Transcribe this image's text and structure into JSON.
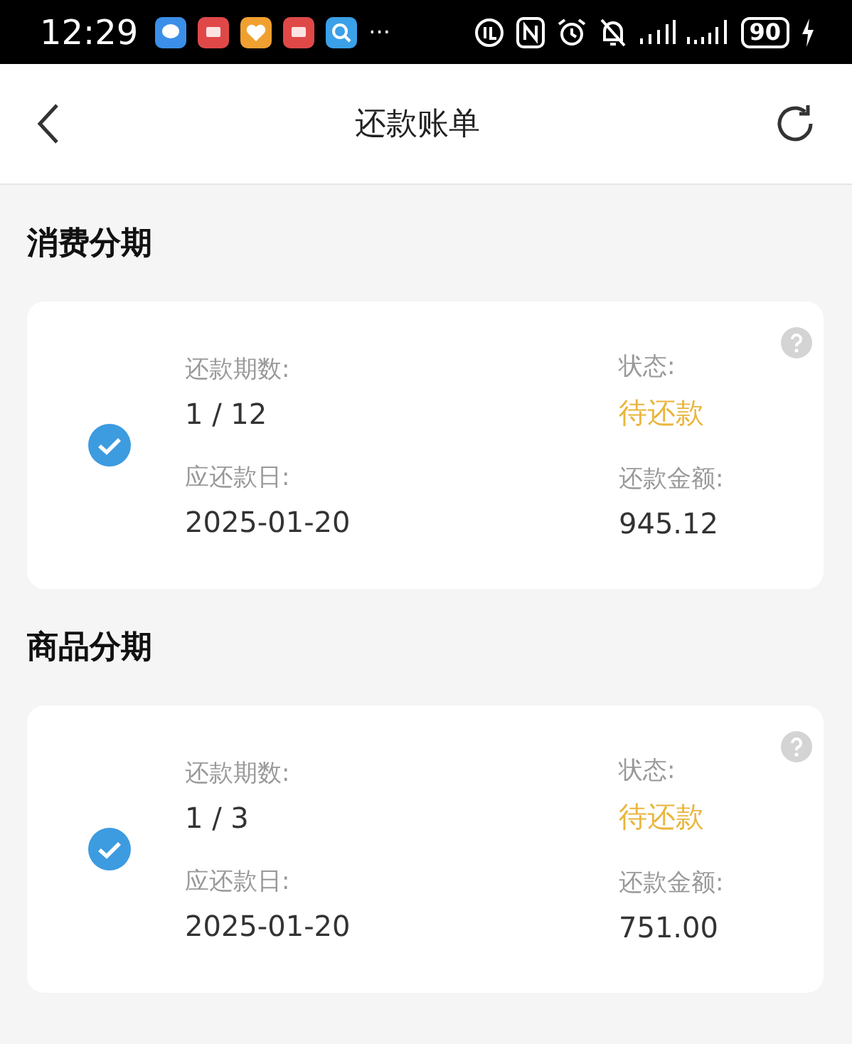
{
  "status_bar": {
    "time": "12:29",
    "overflow": "···",
    "battery": "90"
  },
  "header": {
    "title": "还款账单"
  },
  "sections": [
    {
      "title": "消费分期",
      "bill": {
        "checked": true,
        "period_label": "还款期数:",
        "period": "1 / 12",
        "status_label": "状态:",
        "status": "待还款",
        "due_label": "应还款日:",
        "due_date": "2025-01-20",
        "amount_label": "还款金额:",
        "amount": "945.12"
      }
    },
    {
      "title": "商品分期",
      "bill": {
        "checked": true,
        "period_label": "还款期数:",
        "period": "1 / 3",
        "status_label": "状态:",
        "status": "待还款",
        "due_label": "应还款日:",
        "due_date": "2025-01-20",
        "amount_label": "还款金额:",
        "amount": "751.00"
      }
    }
  ]
}
